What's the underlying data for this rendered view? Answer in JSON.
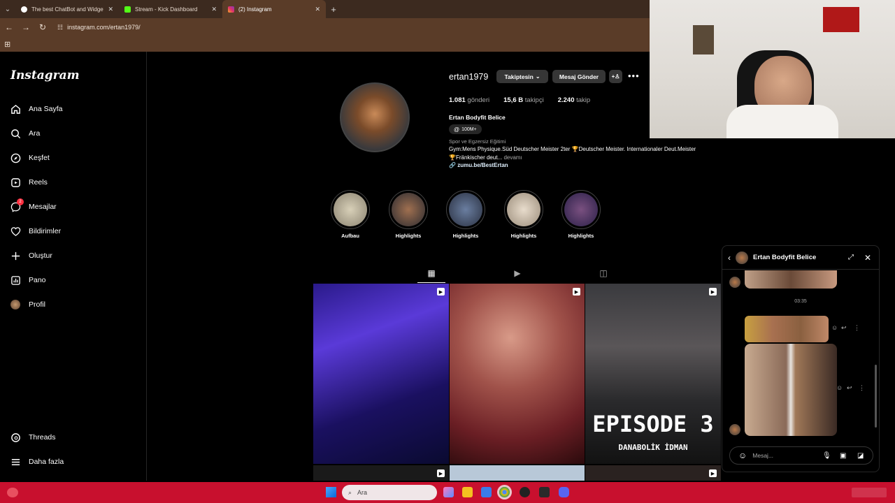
{
  "browser": {
    "tabs": [
      {
        "title": "The best ChatBot and Widgets"
      },
      {
        "title": "Stream - Kick Dashboard"
      },
      {
        "title": "(2) Instagram"
      }
    ],
    "url": "instagram.com/ertan1979/"
  },
  "sidebar": {
    "logo": "Instagram",
    "items": [
      {
        "label": "Ana Sayfa",
        "icon": "home-icon"
      },
      {
        "label": "Ara",
        "icon": "search-icon"
      },
      {
        "label": "Keşfet",
        "icon": "compass-icon"
      },
      {
        "label": "Reels",
        "icon": "reels-icon"
      },
      {
        "label": "Mesajlar",
        "icon": "messenger-icon",
        "badge": "2"
      },
      {
        "label": "Bildirimler",
        "icon": "heart-icon"
      },
      {
        "label": "Oluştur",
        "icon": "plus-icon"
      },
      {
        "label": "Pano",
        "icon": "dashboard-icon"
      },
      {
        "label": "Profil",
        "icon": "avatar-icon"
      }
    ],
    "bottom": [
      {
        "label": "Threads",
        "icon": "threads-icon"
      },
      {
        "label": "Daha fazla",
        "icon": "menu-icon"
      }
    ]
  },
  "profile": {
    "username": "ertan1979",
    "follow_label": "Takiptesin",
    "message_label": "Mesaj Gönder",
    "stats": {
      "posts_num": "1.081",
      "posts_label": "gönderi",
      "followers_num": "15,6 B",
      "followers_label": "takipçi",
      "following_num": "2.240",
      "following_label": "takip"
    },
    "full_name": "Ertan Bodyfit Belice",
    "threads_chip": "100M+",
    "category": "Spor ve Egzersiz Eğitimi",
    "bio_line1": "Gym:Mens Physique.Süd Deutscher Meister 2ter 🏆Deutscher Meister. Internationaler Deut.Meister",
    "bio_line2": "🏆Fränkischer deut...",
    "bio_more": "devamı",
    "link": "zumu.be/BestErtan"
  },
  "highlights": [
    {
      "label": "Aufbau"
    },
    {
      "label": "Highlights"
    },
    {
      "label": "Highlights"
    },
    {
      "label": "Highlights"
    },
    {
      "label": "Highlights"
    }
  ],
  "posts": {
    "episode_title": "EPISODE 3",
    "episode_subtitle": "DANABOLİK İDMAN"
  },
  "dm": {
    "name": "Ertan Bodyfit Belice",
    "timestamp": "03:35",
    "placeholder": "Mesaj..."
  },
  "taskbar": {
    "search_placeholder": "Ara"
  },
  "colors": {
    "accent": "#c8102e",
    "browser_chrome": "#5a3c28"
  }
}
